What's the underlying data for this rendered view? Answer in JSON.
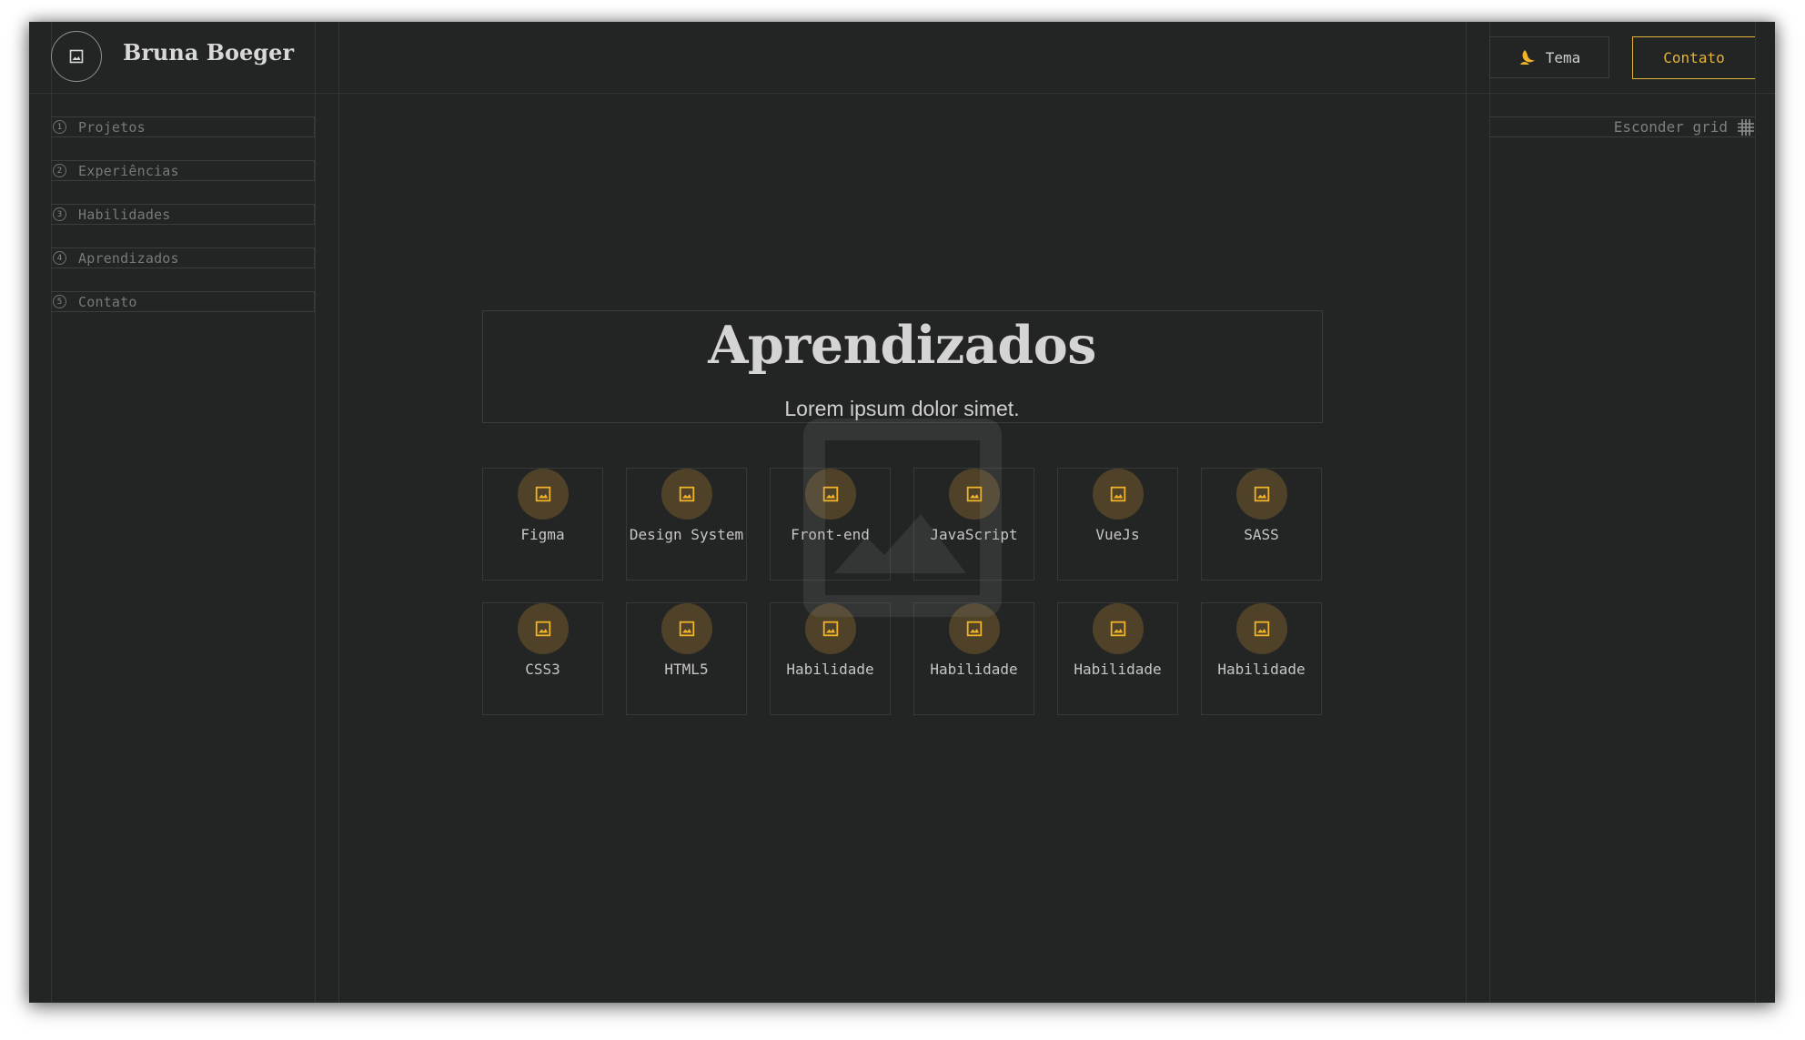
{
  "header": {
    "brand": "Bruna Boeger",
    "logo_icon": "image-icon",
    "theme_button": {
      "label": "Tema",
      "icon": "moon-icon"
    },
    "contact_button": {
      "label": "Contato"
    }
  },
  "nav": {
    "items": [
      {
        "number": "1",
        "label": "Projetos"
      },
      {
        "number": "2",
        "label": "Experiências"
      },
      {
        "number": "3",
        "label": "Habilidades"
      },
      {
        "number": "4",
        "label": "Aprendizados"
      },
      {
        "number": "5",
        "label": "Contato"
      }
    ]
  },
  "grid_toggle": {
    "label": "Esconder grid",
    "icon": "grid-icon"
  },
  "section": {
    "title": "Aprendizados",
    "subtitle": "Lorem ipsum dolor simet."
  },
  "skills": [
    {
      "label": "Figma",
      "icon": "image-icon"
    },
    {
      "label": "Design System",
      "icon": "image-icon"
    },
    {
      "label": "Front-end",
      "icon": "image-icon"
    },
    {
      "label": "JavaScript",
      "icon": "image-icon"
    },
    {
      "label": "VueJs",
      "icon": "image-icon"
    },
    {
      "label": "SASS",
      "icon": "image-icon"
    },
    {
      "label": "CSS3",
      "icon": "image-icon"
    },
    {
      "label": "HTML5",
      "icon": "image-icon"
    },
    {
      "label": "Habilidade",
      "icon": "image-icon"
    },
    {
      "label": "Habilidade",
      "icon": "image-icon"
    },
    {
      "label": "Habilidade",
      "icon": "image-icon"
    },
    {
      "label": "Habilidade",
      "icon": "image-icon"
    }
  ],
  "colors": {
    "background": "#232524",
    "accent": "#e3b23a",
    "icon_circle": "#4f4229",
    "text": "#d4d4d4",
    "muted": "#777978"
  }
}
